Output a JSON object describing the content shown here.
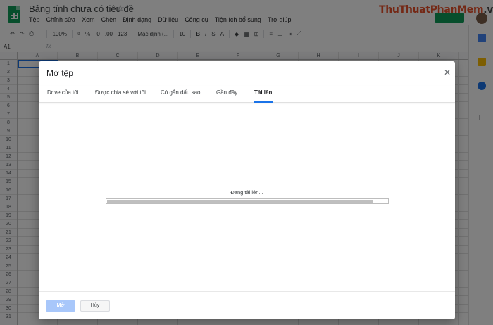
{
  "document": {
    "title": "Bảng tính chưa có tiêu đề",
    "star_icon": "star-outline-icon"
  },
  "menu": [
    "Tệp",
    "Chỉnh sửa",
    "Xem",
    "Chèn",
    "Định dạng",
    "Dữ liệu",
    "Công cụ",
    "Tiện ích bổ sung",
    "Trợ giúp"
  ],
  "brand": {
    "part1": "ThuThuat",
    "part2": "PhanMem",
    "part3": ".vn"
  },
  "toolbar": {
    "zoom": "100%",
    "percent": "%",
    "decimal_dec": ".0",
    "decimal_inc": ".00",
    "number_format": "123",
    "font": "Mặc định (...",
    "font_size": "10",
    "bold": "B",
    "italic": "I",
    "strike": "S",
    "text_color": "A"
  },
  "formula_bar": {
    "cell_ref": "A1",
    "fx": "fx"
  },
  "columns": [
    "A",
    "B",
    "C",
    "D",
    "E",
    "F",
    "G",
    "H",
    "I",
    "J",
    "K"
  ],
  "rows": [
    "1",
    "2",
    "3",
    "4",
    "5",
    "6",
    "7",
    "8",
    "9",
    "10",
    "11",
    "12",
    "13",
    "14",
    "15",
    "16",
    "17",
    "18",
    "19",
    "20",
    "21",
    "22",
    "23",
    "24",
    "25",
    "26",
    "27",
    "28",
    "29",
    "30",
    "31"
  ],
  "dialog": {
    "title": "Mở tệp",
    "close_icon": "close-icon",
    "tabs": [
      {
        "label": "Drive của tôi",
        "active": false
      },
      {
        "label": "Được chia sẻ với tôi",
        "active": false
      },
      {
        "label": "Có gắn dấu sao",
        "active": false
      },
      {
        "label": "Gần đây",
        "active": false
      },
      {
        "label": "Tải lên",
        "active": true
      }
    ],
    "upload_status": "Đang tải lên...",
    "progress_fraction": 0.95,
    "open_button": "Mở",
    "cancel_button": "Hủy"
  },
  "colors": {
    "accent": "#1a73e8",
    "sheets_green": "#0f9d58",
    "open_button_disabled": "#a8c7fa"
  }
}
